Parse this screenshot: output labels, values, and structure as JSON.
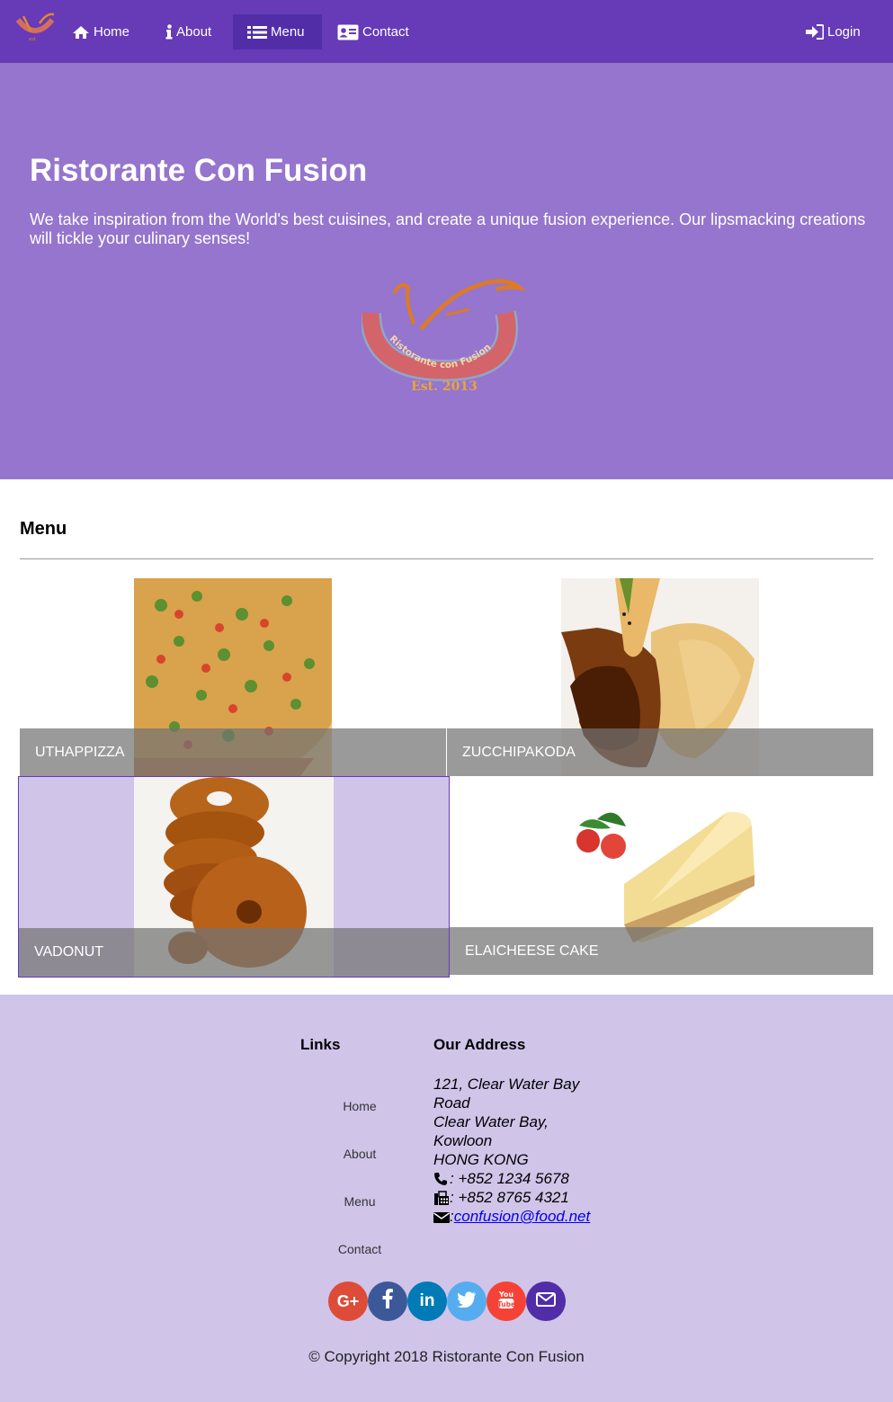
{
  "nav": {
    "items": [
      {
        "label": "Home",
        "icon": "home-icon"
      },
      {
        "label": "About",
        "icon": "info-icon"
      },
      {
        "label": "Menu",
        "icon": "list-icon",
        "active": true
      },
      {
        "label": "Contact",
        "icon": "address-card-icon"
      }
    ],
    "login": {
      "label": "Login",
      "icon": "sign-in-icon"
    }
  },
  "jumbotron": {
    "title": "Ristorante Con Fusion",
    "text": "We take inspiration from the World's best cuisines, and create a unique fusion experience. Our lipsmacking creations will tickle your culinary senses!",
    "logo": {
      "ring_text": "Ristorante con Fusion",
      "est": "Est. 2013"
    }
  },
  "menu": {
    "heading": "Menu",
    "dishes": [
      {
        "name": "UTHAPPIZZA"
      },
      {
        "name": "ZUCCHIPAKODA"
      },
      {
        "name": "VADONUT"
      },
      {
        "name": "ELAICHEESE CAKE"
      }
    ]
  },
  "footer": {
    "links_title": "Links",
    "links": [
      "Home",
      "About",
      "Menu",
      "Contact"
    ],
    "address_title": "Our Address",
    "address_lines": [
      "121, Clear Water Bay",
      "Road",
      "Clear Water Bay,",
      "Kowloon",
      "HONG KONG"
    ],
    "phone": ": +852 1234 5678",
    "fax": ": +852 8765 4321",
    "email_prefix": ": ",
    "email": "confusion@food.net",
    "social": [
      {
        "name": "google-plus",
        "color": "#dd4b39"
      },
      {
        "name": "facebook",
        "color": "#3b5998"
      },
      {
        "name": "linkedin",
        "color": "#007bb6"
      },
      {
        "name": "twitter",
        "color": "#55acee"
      },
      {
        "name": "youtube",
        "color": "#f44336"
      },
      {
        "name": "mail",
        "color": "#512da8"
      }
    ],
    "copyright": "© Copyright 2018 Ristorante Con Fusion"
  },
  "colors": {
    "primary": "#673ab7",
    "primary_dark": "#512da8",
    "jumbotron": "#9575cd",
    "footer": "#d1c4e9"
  }
}
